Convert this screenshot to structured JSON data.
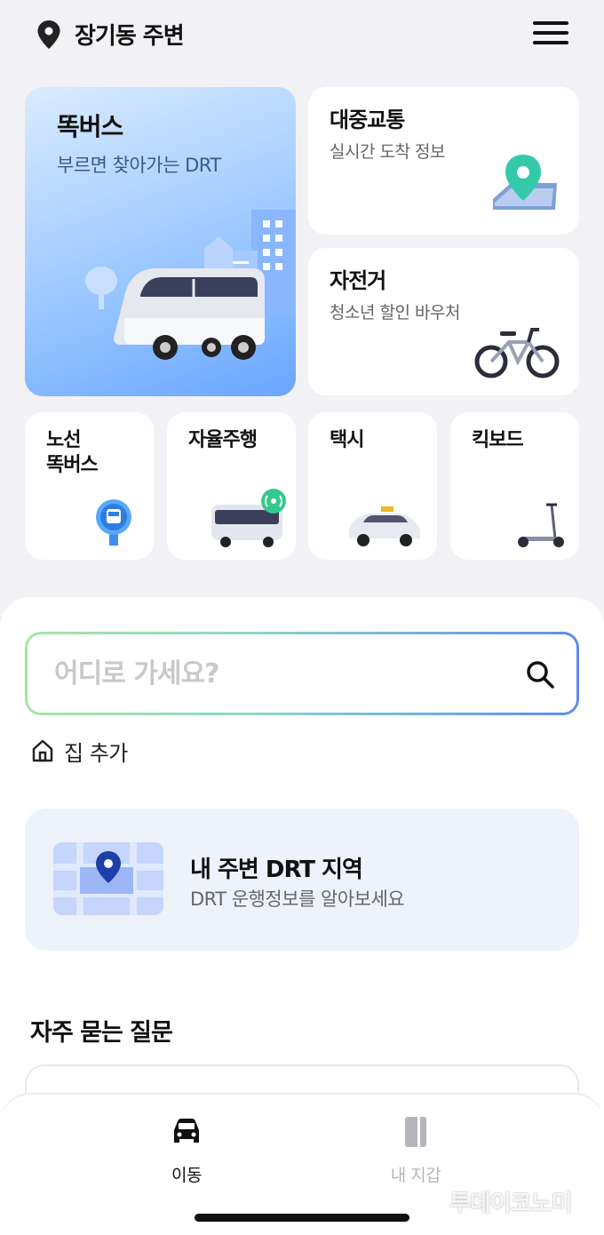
{
  "header": {
    "location": "장기동 주변"
  },
  "services": {
    "ddokbus": {
      "title": "똑버스",
      "subtitle": "부르면 찾아가는 DRT"
    },
    "public_transit": {
      "title": "대중교통",
      "subtitle": "실시간 도착 정보"
    },
    "bicycle": {
      "title": "자전거",
      "subtitle": "청소년 할인 바우처"
    },
    "route_bus": {
      "title_line1": "노선",
      "title_line2": "똑버스"
    },
    "autonomous": {
      "title": "자율주행"
    },
    "taxi": {
      "title": "택시"
    },
    "kickboard": {
      "title": "킥보드"
    }
  },
  "search": {
    "placeholder": "어디로 가세요?"
  },
  "home_add": {
    "label": "집 추가"
  },
  "drt_area": {
    "title": "내 주변 DRT 지역",
    "subtitle": "DRT 운행정보를 알아보세요"
  },
  "faq": {
    "title": "자주 묻는 질문"
  },
  "tabbar": {
    "tabs": [
      {
        "label": "이동",
        "active": true
      },
      {
        "label": "내 지갑",
        "active": false
      }
    ]
  },
  "watermark": "투데이코노미",
  "colors": {
    "accent": "#3a6ef0",
    "bus_card": "#8fbfff",
    "inactive_tab": "#b5b5bb"
  }
}
